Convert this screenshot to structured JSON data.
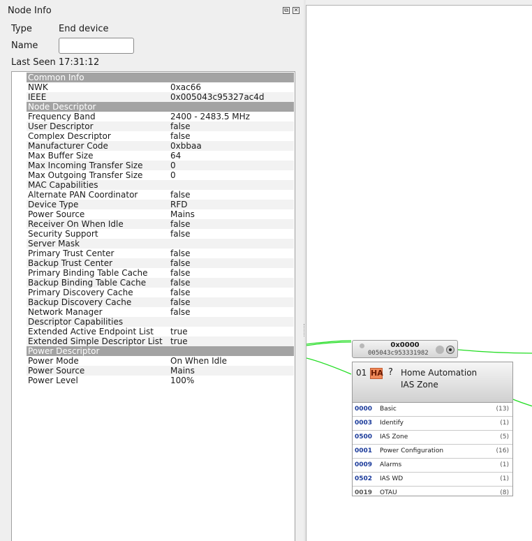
{
  "dock": {
    "title": "Node Info",
    "float_glyph": "⧉",
    "close_glyph": "✕",
    "type_label": "Type",
    "type_value": "End device",
    "name_label": "Name",
    "name_value": "",
    "last_seen": "Last Seen 17:31:12"
  },
  "table": {
    "sections": [
      {
        "title": "Common Info",
        "rows": [
          {
            "key": "NWK",
            "value": "0xac66"
          },
          {
            "key": "IEEE",
            "value": "0x005043c95327ac4d"
          }
        ]
      },
      {
        "title": "Node Descriptor",
        "rows": [
          {
            "key": "Frequency Band",
            "value": "2400 - 2483.5 MHz"
          },
          {
            "key": "User Descriptor",
            "value": "false"
          },
          {
            "key": "Complex Descriptor",
            "value": "false"
          },
          {
            "key": "Manufacturer Code",
            "value": "0xbbaa"
          },
          {
            "key": "Max Buffer Size",
            "value": "64"
          },
          {
            "key": "Max Incoming Transfer Size",
            "value": "0"
          },
          {
            "key": "Max Outgoing Transfer Size",
            "value": "0"
          },
          {
            "key": "MAC Capabilities",
            "value": ""
          },
          {
            "key": "Alternate PAN Coordinator",
            "value": "false"
          },
          {
            "key": "Device Type",
            "value": "RFD"
          },
          {
            "key": "Power Source",
            "value": "Mains"
          },
          {
            "key": "Receiver On When Idle",
            "value": "false"
          },
          {
            "key": "Security Support",
            "value": "false"
          },
          {
            "key": "Server Mask",
            "value": ""
          },
          {
            "key": "Primary Trust Center",
            "value": "false"
          },
          {
            "key": "Backup Trust Center",
            "value": "false"
          },
          {
            "key": "Primary Binding Table Cache",
            "value": "false"
          },
          {
            "key": "Backup Binding Table Cache",
            "value": "false"
          },
          {
            "key": "Primary Discovery Cache",
            "value": "false"
          },
          {
            "key": "Backup Discovery Cache",
            "value": "false"
          },
          {
            "key": "Network Manager",
            "value": "false"
          },
          {
            "key": "Descriptor Capabilities",
            "value": ""
          },
          {
            "key": "Extended Active Endpoint List",
            "value": "true"
          },
          {
            "key": "Extended Simple Descriptor List",
            "value": "true"
          }
        ]
      },
      {
        "title": "Power Descriptor",
        "rows": [
          {
            "key": "Power Mode",
            "value": "On When Idle"
          },
          {
            "key": "Power Source",
            "value": "Mains"
          },
          {
            "key": "Power Level",
            "value": "100%"
          }
        ]
      }
    ]
  },
  "node": {
    "address": "0x0000",
    "mac": "005043c953331982"
  },
  "endpoint": {
    "number": "01",
    "badge": "HA",
    "question": "?",
    "profile": "Home Automation",
    "device": "IAS Zone",
    "clusters": [
      {
        "id": "0000",
        "name": "Basic",
        "count": "(13)",
        "active": true
      },
      {
        "id": "0003",
        "name": "Identify",
        "count": "(1)",
        "active": true
      },
      {
        "id": "0500",
        "name": "IAS Zone",
        "count": "(5)",
        "active": true
      },
      {
        "id": "0001",
        "name": "Power Configuration",
        "count": "(16)",
        "active": true
      },
      {
        "id": "0009",
        "name": "Alarms",
        "count": "(1)",
        "active": true
      },
      {
        "id": "0502",
        "name": "IAS WD",
        "count": "(1)",
        "active": true
      },
      {
        "id": "0019",
        "name": "OTAU",
        "count": "(8)",
        "active": false
      }
    ]
  },
  "colors": {
    "wire": "#22dd22",
    "cluster_id": "#1a3a9a",
    "section_header": "#a3a3a3"
  }
}
